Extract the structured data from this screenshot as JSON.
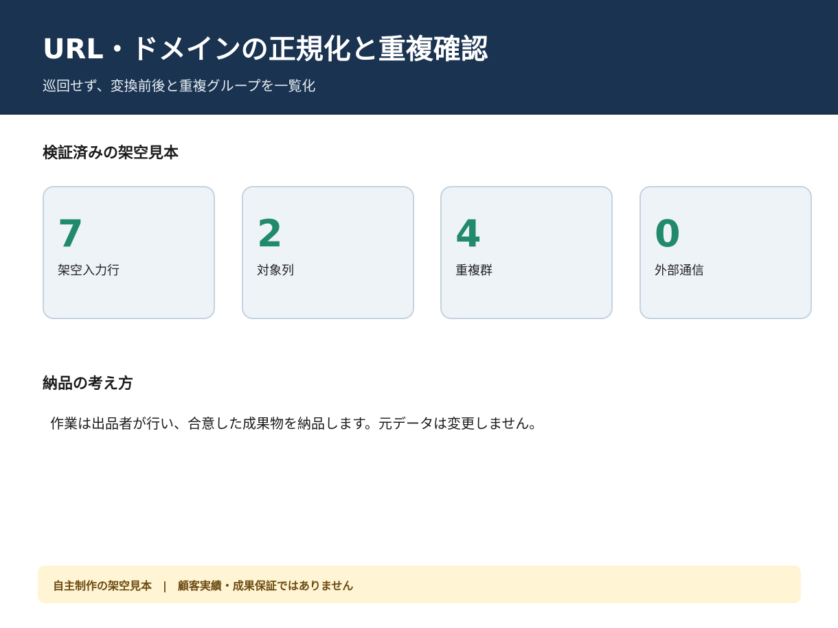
{
  "header": {
    "title": "URL・ドメインの正規化と重複確認",
    "subtitle": "巡回せず、変換前後と重複グループを一覧化"
  },
  "samples": {
    "heading": "検証済みの架空見本",
    "stats": [
      {
        "value": "7",
        "label": "架空入力行"
      },
      {
        "value": "2",
        "label": "対象列"
      },
      {
        "value": "4",
        "label": "重複群"
      },
      {
        "value": "0",
        "label": "外部通信"
      }
    ]
  },
  "approach": {
    "heading": "納品の考え方",
    "text": "作業は出品者が行い、合意した成果物を納品します。元データは変更しません。"
  },
  "footer": {
    "disclaimer": "自主制作の架空見本　|　顧客実績・成果保証ではありません"
  },
  "colors": {
    "header_bg": "#1a3350",
    "accent_value": "#228a6c",
    "card_bg": "#eef3f8",
    "card_border": "#c4d3e0",
    "disclaimer_bg": "#fff4d4",
    "disclaimer_text": "#6b4a10"
  }
}
